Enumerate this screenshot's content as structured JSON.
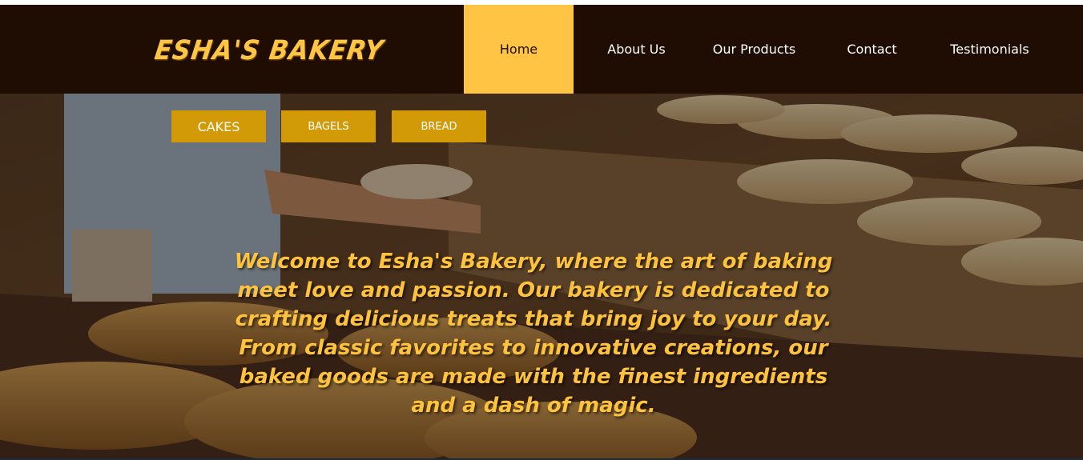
{
  "brand": {
    "logo_text": "ESHA'S BAKERY"
  },
  "nav": {
    "items": [
      {
        "label": "Home",
        "active": true
      },
      {
        "label": "About Us",
        "active": false
      },
      {
        "label": "Our Products",
        "active": false
      },
      {
        "label": "Contact",
        "active": false
      },
      {
        "label": "Testimonials",
        "active": false
      }
    ]
  },
  "categories": {
    "buttons": [
      {
        "label": "CAKES"
      },
      {
        "label": "BAGELS"
      },
      {
        "label": "BREAD"
      }
    ]
  },
  "hero": {
    "welcome_text": "Welcome to Esha's Bakery, where the art of baking meet love and passion. Our bakery is dedicated to crafting delicious treats that bring joy to your day. From classic favorites to innovative creations, our baked goods are made with the finest ingredients and a dash of magic."
  },
  "colors": {
    "header_bg": "#1f0d04",
    "accent_yellow": "#ffc444",
    "button_gold": "#d29a06",
    "text_gold": "#ffc23d"
  }
}
